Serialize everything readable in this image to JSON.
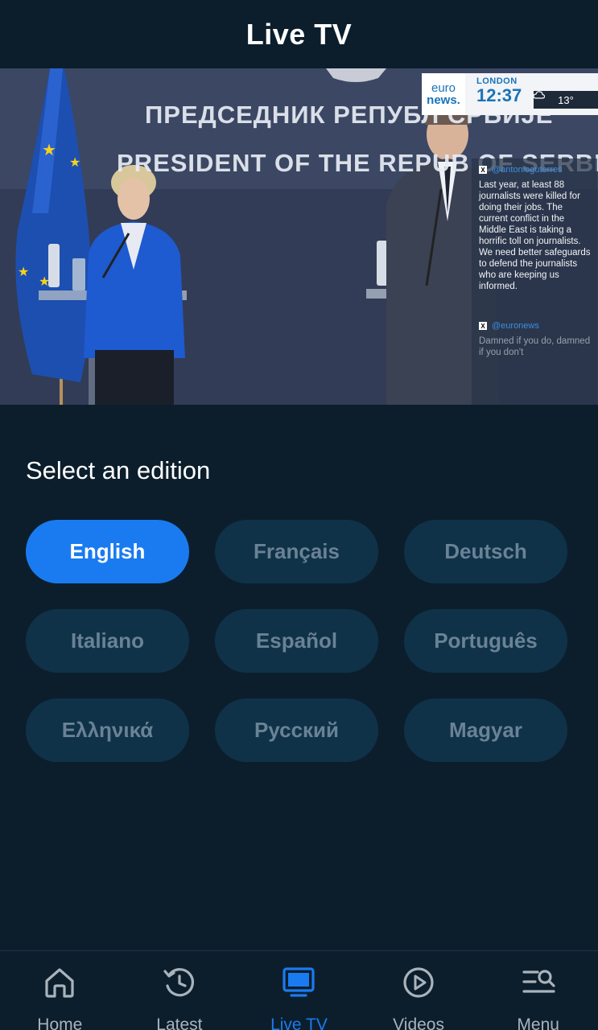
{
  "header": {
    "title": "Live TV"
  },
  "player": {
    "banner_cyrillic": "ПРЕДСЕДНИК РЕПУБЛ  СРБИЈЕ",
    "banner_english": "PRESIDENT OF THE REPUB    OF SERBI",
    "bug": {
      "logo_line1": "euro",
      "logo_line2": "news.",
      "city": "LONDON",
      "time": "12:37",
      "temperature": "13°"
    },
    "social": {
      "handle1": "@antonioguterres",
      "post1": "Last year, at least 88 journalists were killed for doing their jobs. The current conflict in the Middle East is taking a horrific toll on journalists. We need better safeguards to defend the journalists who are keeping us informed.",
      "handle2": "@euronews",
      "post2": "Damned if you do, damned if you don't"
    }
  },
  "editions": {
    "title": "Select an edition",
    "selected": "English",
    "items": [
      {
        "label": "English"
      },
      {
        "label": "Français"
      },
      {
        "label": "Deutsch"
      },
      {
        "label": "Italiano"
      },
      {
        "label": "Español"
      },
      {
        "label": "Português"
      },
      {
        "label": "Ελληνικά"
      },
      {
        "label": "Русский"
      },
      {
        "label": "Magyar"
      }
    ]
  },
  "nav": {
    "items": [
      {
        "label": "Home",
        "icon": "home-icon"
      },
      {
        "label": "Latest",
        "icon": "clock-history-icon"
      },
      {
        "label": "Live TV",
        "icon": "tv-icon"
      },
      {
        "label": "Videos",
        "icon": "play-circle-icon"
      },
      {
        "label": "Menu",
        "icon": "menu-search-icon"
      }
    ],
    "active": "Live TV"
  },
  "colors": {
    "background": "#0c1e2c",
    "accent": "#1a7bf0",
    "pill": "#0f3249",
    "pill_text": "#6a8295",
    "nav_text": "#a9b3bc"
  }
}
